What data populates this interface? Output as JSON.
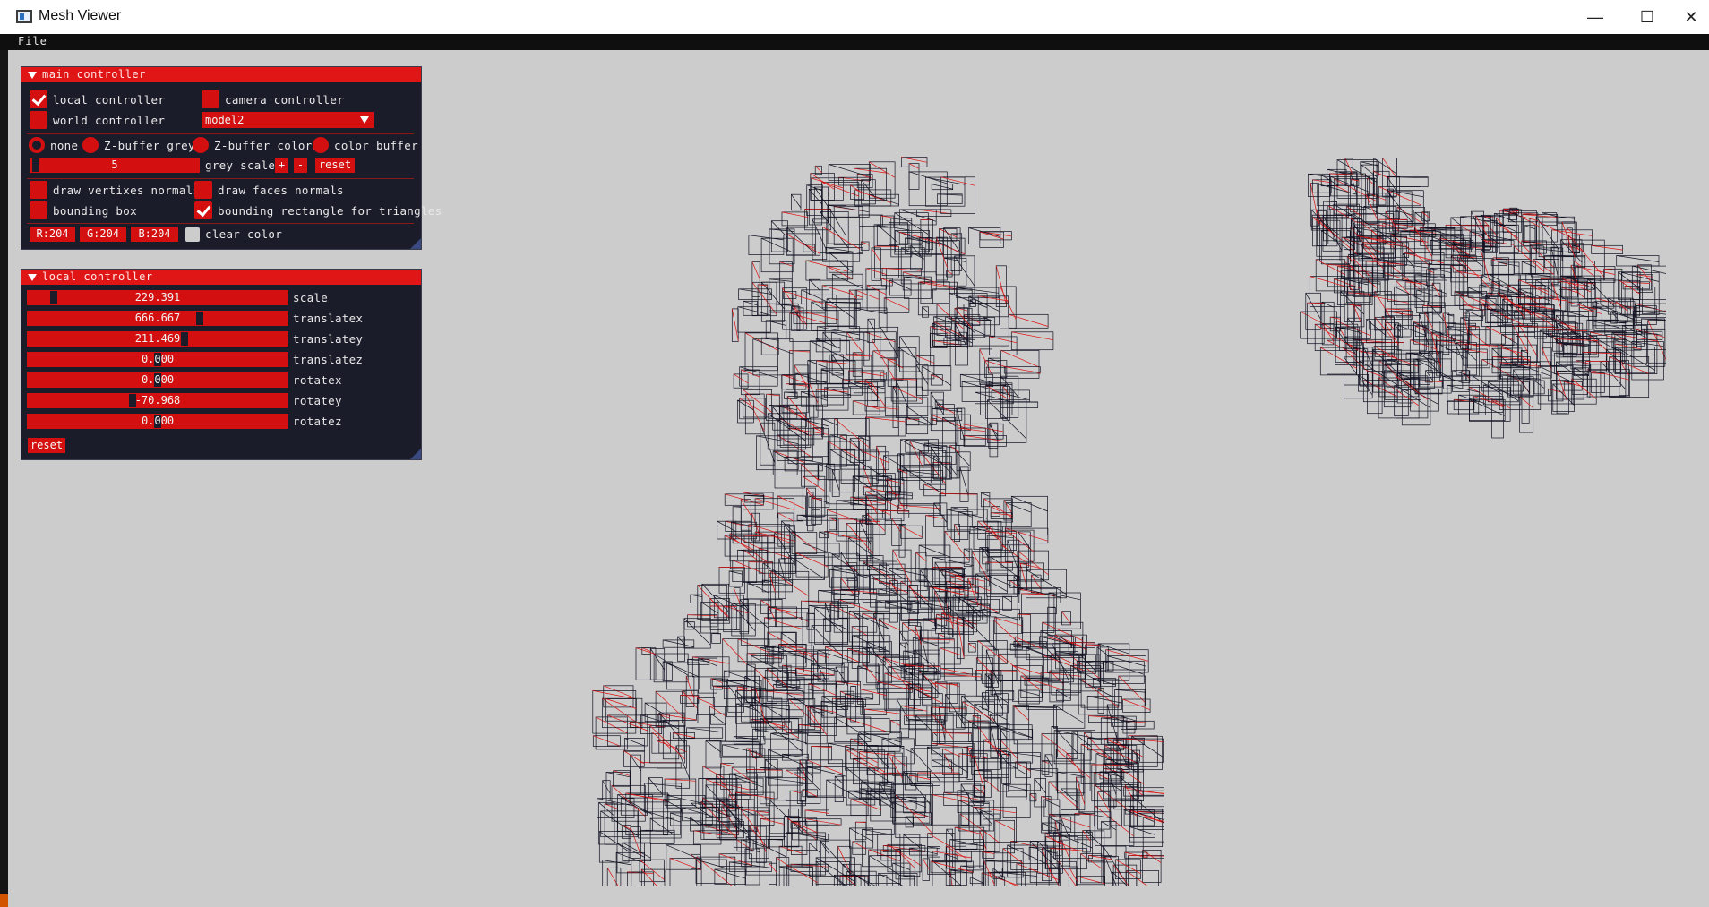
{
  "window": {
    "title": "Mesh Viewer",
    "minimize": "—",
    "maximize": "☐",
    "close": "✕"
  },
  "menu": {
    "file": "File"
  },
  "main_controller": {
    "header": "main controller",
    "local_controller": {
      "label": "local controller",
      "checked": true
    },
    "camera_controller": {
      "label": "camera controller",
      "checked": false
    },
    "world_controller": {
      "label": "world controller",
      "checked": false
    },
    "model_select": {
      "value": "model2"
    },
    "render_modes": [
      "none",
      "Z-buffer grey",
      "Z-buffer colors",
      "color buffer"
    ],
    "render_mode_selected": "none",
    "grey_scale": {
      "value": "5",
      "label": "grey scale",
      "plus": "+",
      "minus": "-",
      "reset": "reset"
    },
    "draw_vertex_normals": {
      "label": "draw vertixes normals",
      "checked": false
    },
    "draw_face_normals": {
      "label": "draw faces normals",
      "checked": false
    },
    "bounding_box": {
      "label": "bounding box",
      "checked": false
    },
    "bounding_rect_triangles": {
      "label": "bounding rectangle for triangles",
      "checked": true
    },
    "clear_color": {
      "r": "R:204",
      "g": "G:204",
      "b": "B:204",
      "label": "clear color",
      "hex": "#cccccc"
    }
  },
  "local_controller": {
    "header": "local controller",
    "sliders": [
      {
        "label": "scale",
        "value": "229.391",
        "fraction": 0.08
      },
      {
        "label": "translatex",
        "value": "666.667",
        "fraction": 0.67
      },
      {
        "label": "translatey",
        "value": "211.469",
        "fraction": 0.61
      },
      {
        "label": "translatez",
        "value": "0.000",
        "fraction": 0.5
      },
      {
        "label": "rotatex",
        "value": "0.000",
        "fraction": 0.5
      },
      {
        "label": "rotatey",
        "value": "-70.968",
        "fraction": 0.4
      },
      {
        "label": "rotatez",
        "value": "0.000",
        "fraction": 0.5
      }
    ],
    "reset": "reset"
  },
  "colors": {
    "accent": "#d40f0f",
    "header": "#e01616",
    "panel_bg": "#1b1c2a",
    "viewport_bg": "#cccccc",
    "wire_black": "#111122",
    "wire_red": "#e01010"
  }
}
